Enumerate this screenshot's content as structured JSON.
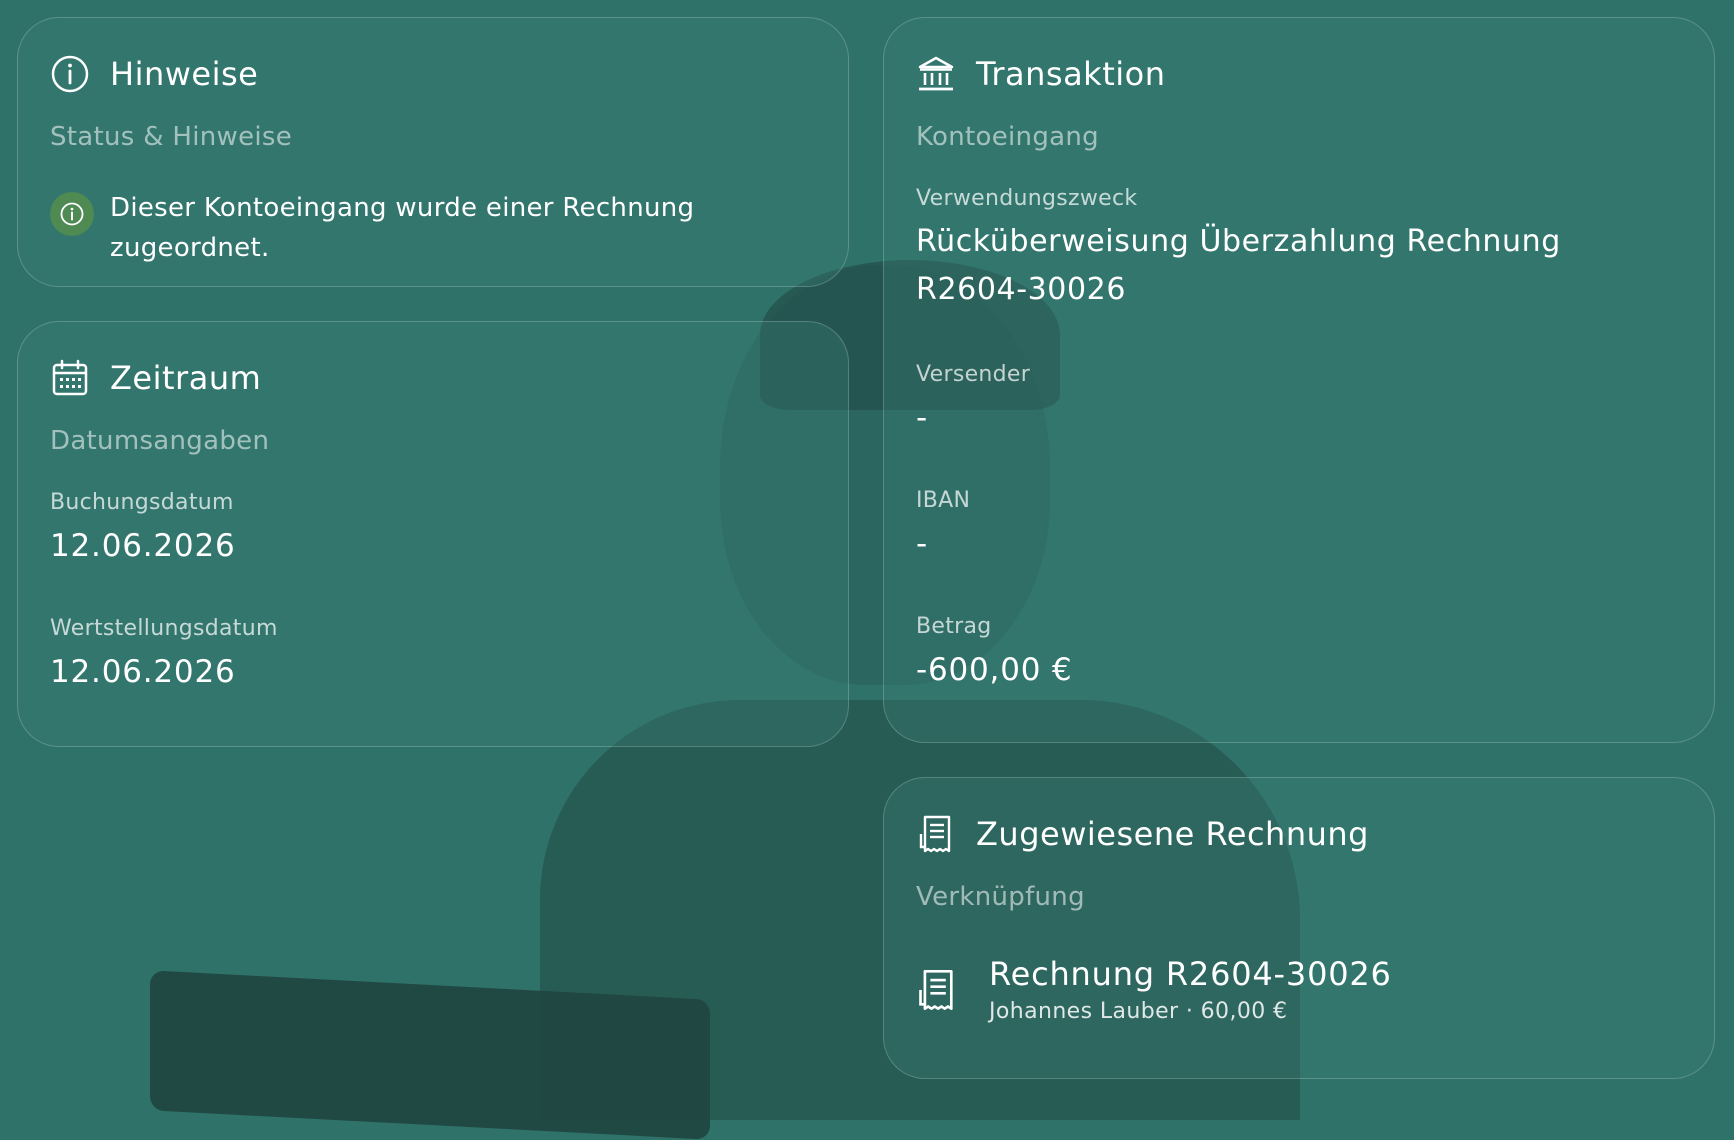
{
  "notes": {
    "title": "Hinweise",
    "subtitle": "Status & Hinweise",
    "message": "Dieser Kontoeingang wurde einer Rechnung zugeordnet."
  },
  "period": {
    "title": "Zeitraum",
    "subtitle": "Datumsangaben",
    "booking_date_label": "Buchungsdatum",
    "booking_date": "12.06.2026",
    "value_date_label": "Wertstellungsdatum",
    "value_date": "12.06.2026"
  },
  "transaction": {
    "title": "Transaktion",
    "subtitle": "Kontoeingang",
    "purpose_label": "Verwendungszweck",
    "purpose": "Rücküberweisung Überzahlung Rechnung R2604-30026",
    "sender_label": "Versender",
    "sender": "-",
    "iban_label": "IBAN",
    "iban": "-",
    "amount_label": "Betrag",
    "amount": "-600,00 €"
  },
  "assigned": {
    "title": "Zugewiesene Rechnung",
    "subtitle": "Verknüpfung",
    "invoice_title": "Rechnung R2604-30026",
    "invoice_meta": "Johannes Lauber · 60,00 €"
  },
  "icons": {
    "notes": "info-icon",
    "period": "calendar-icon",
    "transaction": "bank-icon",
    "assigned": "receipt-icon"
  },
  "colors": {
    "background": "#2f7269",
    "badge": "#4f8a53"
  }
}
